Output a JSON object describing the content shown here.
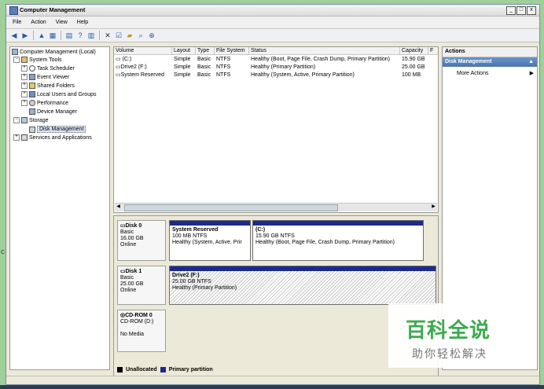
{
  "window": {
    "title": "Computer Management",
    "buttons": [
      "_",
      "□",
      "x"
    ]
  },
  "menu": [
    "File",
    "Action",
    "View",
    "Help"
  ],
  "toolbar": {
    "icons": [
      "back-arrow-icon",
      "forward-arrow-icon",
      "up-folder-icon",
      "console-tree-icon",
      "properties-icon",
      "help-icon",
      "view-icon",
      "delete-icon",
      "checkbox-icon",
      "folder-icon",
      "search-icon",
      "zoom-icon"
    ]
  },
  "tree": [
    {
      "label": "Computer Management (Local)",
      "level": 0,
      "expander": ""
    },
    {
      "label": "System Tools",
      "level": 1,
      "expander": "−"
    },
    {
      "label": "Task Scheduler",
      "level": 2,
      "expander": "+"
    },
    {
      "label": "Event Viewer",
      "level": 2,
      "expander": "+"
    },
    {
      "label": "Shared Folders",
      "level": 2,
      "expander": "+"
    },
    {
      "label": "Local Users and Groups",
      "level": 2,
      "expander": "+"
    },
    {
      "label": "Performance",
      "level": 2,
      "expander": "+"
    },
    {
      "label": "Device Manager",
      "level": 2,
      "expander": ""
    },
    {
      "label": "Storage",
      "level": 1,
      "expander": "−"
    },
    {
      "label": "Disk Management",
      "level": 2,
      "expander": "",
      "selected": true
    },
    {
      "label": "Services and Applications",
      "level": 1,
      "expander": "+"
    }
  ],
  "volumes": {
    "columns": [
      "Volume",
      "Layout",
      "Type",
      "File System",
      "Status",
      "Capacity",
      "F"
    ],
    "rows": [
      [
        "(C:)",
        "Simple",
        "Basic",
        "NTFS",
        "Healthy (Boot, Page File, Crash Dump, Primary Partition)",
        "15.90 GB",
        ""
      ],
      [
        "Drive2 (F:)",
        "Simple",
        "Basic",
        "NTFS",
        "Healthy (Primary Partition)",
        "25.00 GB",
        ""
      ],
      [
        "System Reserved",
        "Simple",
        "Basic",
        "NTFS",
        "Healthy (System, Active, Primary Partition)",
        "100 MB",
        ""
      ]
    ]
  },
  "disks": [
    {
      "name": "Disk 0",
      "type": "Basic",
      "size": "16.00 GB",
      "status": "Online",
      "partitions": [
        {
          "name": "System Reserved",
          "size": "100 MB NTFS",
          "status": "Healthy (System, Active, Prir"
        },
        {
          "name": "(C:)",
          "size": "15.90 GB NTFS",
          "status": "Healthy (Boot, Page File, Crash Dump, Primary Partition)"
        }
      ]
    },
    {
      "name": "Disk 1",
      "type": "Basic",
      "size": "25.00 GB",
      "status": "Online",
      "partitions": [
        {
          "name": "Drive2  (F:)",
          "size": "25.00 GB NTFS",
          "status": "Healthy (Primary Partition)"
        }
      ]
    },
    {
      "name": "CD-ROM 0",
      "type": "CD-ROM (D:)",
      "size": "",
      "status": "No Media",
      "partitions": []
    }
  ],
  "legend": [
    {
      "label": "Unallocated",
      "color": "#000000"
    },
    {
      "label": "Primary partition",
      "color": "#1c2a8c"
    }
  ],
  "actions": {
    "header": "Actions",
    "section": "Disk Management",
    "item": "More Actions"
  },
  "watermark": {
    "title": "百科全说",
    "subtitle": "助你轻松解决"
  },
  "edge_mark": "C",
  "colors": {
    "primary_partition": "#1c2a8c",
    "action_section": "#4a74ae",
    "watermark_green": "#3daa4e"
  }
}
